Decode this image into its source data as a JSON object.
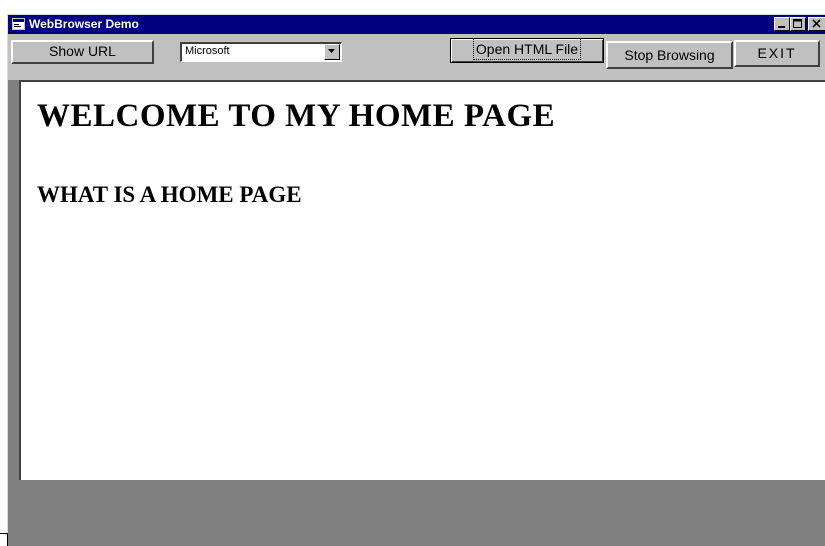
{
  "window": {
    "title": "WebBrowser Demo",
    "title_icon": "app-window-icon",
    "minimize_icon": "minimize-icon",
    "maximize_icon": "maximize-icon",
    "close_icon": "close-icon"
  },
  "toolbar": {
    "show_url_label": "Show URL",
    "combo_value": "Microsoft",
    "combo_arrow_icon": "chevron-down-icon",
    "open_html_label": "Open HTML File",
    "stop_browsing_label": "Stop Browsing",
    "exit_label": "EXIT"
  },
  "page": {
    "heading": "WELCOME TO MY HOME PAGE",
    "subheading": "WHAT IS A HOME PAGE"
  },
  "colors": {
    "titlebar": "#000080",
    "face": "#c0c0c0",
    "window_bg": "#808080",
    "content_bg": "#ffffff"
  }
}
